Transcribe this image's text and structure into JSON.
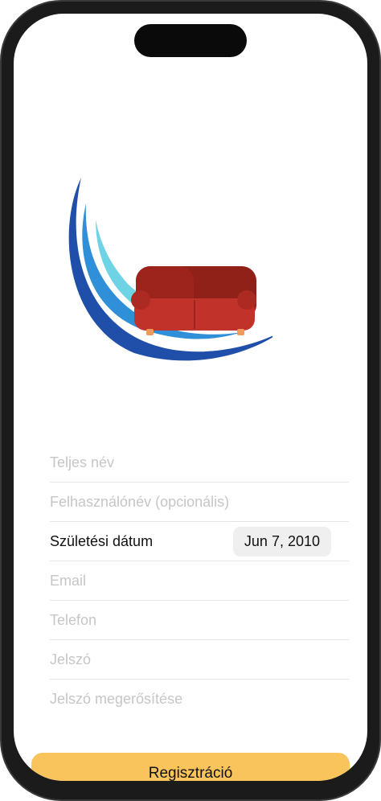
{
  "logo": {
    "icon": "sofa-wave-logo-icon",
    "colors": {
      "sofa": "#c0322a",
      "wave_dark": "#1f4fa8",
      "wave_light": "#6fd3e6"
    }
  },
  "form": {
    "full_name": {
      "placeholder": "Teljes név",
      "value": ""
    },
    "username": {
      "placeholder": "Felhasználónév (opcionális)",
      "value": ""
    },
    "birth_date": {
      "label": "Születési dátum",
      "value": "Jun 7, 2010"
    },
    "email": {
      "placeholder": "Email",
      "value": ""
    },
    "phone": {
      "placeholder": "Telefon",
      "value": ""
    },
    "password": {
      "placeholder": "Jelszó",
      "value": ""
    },
    "password_confirm": {
      "placeholder": "Jelszó megerősítése",
      "value": ""
    }
  },
  "register_button": {
    "label": "Regisztráció",
    "color": "#f9c45c"
  }
}
